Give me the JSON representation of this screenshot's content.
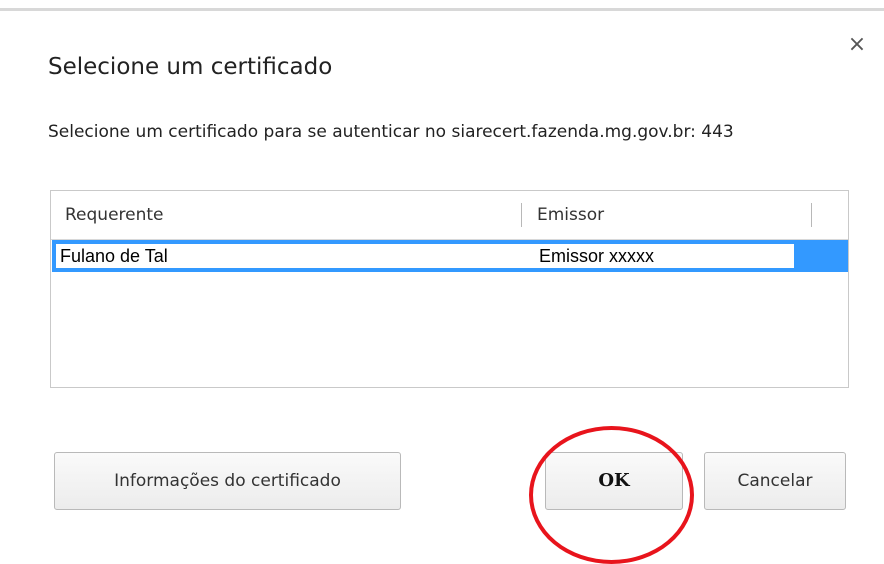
{
  "dialog": {
    "title": "Selecione um certificado",
    "description": "Selecione um certificado para se autenticar no siarecert.fazenda.mg.gov.br: 443",
    "close_symbol": "×"
  },
  "table": {
    "columns": [
      "Requerente",
      "Emissor"
    ],
    "rows": [
      {
        "requerente": "Fulano de Tal",
        "emissor": "Emissor xxxxx",
        "selected": true
      }
    ]
  },
  "buttons": {
    "info": "Informações do certificado",
    "ok": "OK",
    "cancel": "Cancelar"
  },
  "colors": {
    "selection": "#3399ff",
    "highlight_circle": "#e8141c"
  },
  "icons": {
    "close": "close-icon"
  }
}
